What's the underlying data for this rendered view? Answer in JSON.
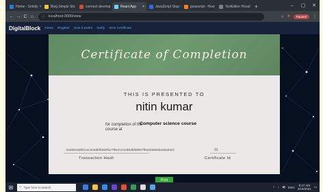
{
  "browser": {
    "tabs": [
      {
        "label": "Home - Sololly",
        "color": "#2b79d8"
      },
      {
        "label": "Blog Simple Sto",
        "color": "#f0c33c"
      },
      {
        "label": "connect develop",
        "color": "#d24b3a"
      },
      {
        "label": "React App",
        "color": "#61dafb",
        "active": true
      },
      {
        "label": "JavaScript Stop",
        "color": "#2d6ae3"
      },
      {
        "label": "javascript - How",
        "color": "#f48024"
      },
      {
        "label": "TextEditor Hoodi",
        "color": "#7a7f88"
      }
    ],
    "new_tab": "+",
    "window_controls": {
      "minimize": "–",
      "maximize": "▢",
      "close": "✕"
    },
    "nav": {
      "back": "←",
      "forward": "→",
      "reload": "C",
      "home": "⌂"
    },
    "url": "localhost:3000/view",
    "paused_label": "Paused"
  },
  "site": {
    "brand": "DigitalBlock",
    "links": [
      "Home",
      "Register",
      "How it works",
      "Verify",
      "View Certificate"
    ]
  },
  "certificate": {
    "title": "Certificate of Completion",
    "presented": "THIS IS PRESENTED TO",
    "recipient": "nitin kumar",
    "completion_label": "for completion of the course at",
    "course": "Computer science course",
    "transaction_hash": "0xd3918d0f214c3e38bf0690f1e7f8e4c2123bdbf59807f8a32680ebe5da934c",
    "transaction_label": "Transaction Hash",
    "certificate_id": "31",
    "certificate_id_label": "Certificate Id",
    "print_label": "Print"
  },
  "taskbar": {
    "search_placeholder": "Type here to search",
    "apps": [
      "#3c7be0",
      "#f4c04a",
      "#2f8de4",
      "#6b47c9",
      "#e34f3b",
      "#3a9c4e",
      "#dcdcdc",
      "#5a9fe8"
    ],
    "tray_text": "ENG",
    "time": "9:27 AM",
    "date": "4/19/2021"
  }
}
